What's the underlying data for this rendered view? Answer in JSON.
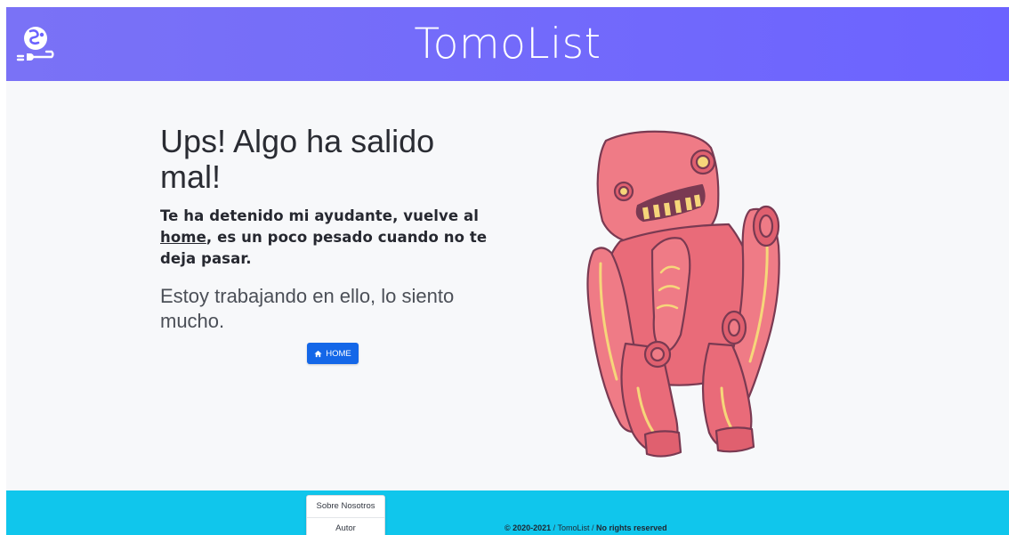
{
  "header": {
    "title": "TomoList"
  },
  "error": {
    "title": "Ups! Algo ha salido mal!",
    "message_part1": "Te ha detenido mi ayudante, vuelve al ",
    "home_link": "home",
    "message_part2": ", es un poco pesado cuando no te deja pasar.",
    "apology": "Estoy trabajando en ello, lo siento mucho."
  },
  "home_button": {
    "label": "HOME",
    "icon": "home-icon"
  },
  "illustration": {
    "name": "robot-illustration"
  },
  "footer": {
    "menu": [
      {
        "label": "Sobre Nosotros"
      },
      {
        "label": "Autor"
      }
    ],
    "copyright_year": "© 2020-2021",
    "separator": " / ",
    "app_name": "TomoList",
    "rights": "No rights reserved"
  },
  "colors": {
    "header": "#6c63ff",
    "footer": "#10c6ec",
    "button": "#1467e8",
    "robot": "#ef7b86"
  }
}
